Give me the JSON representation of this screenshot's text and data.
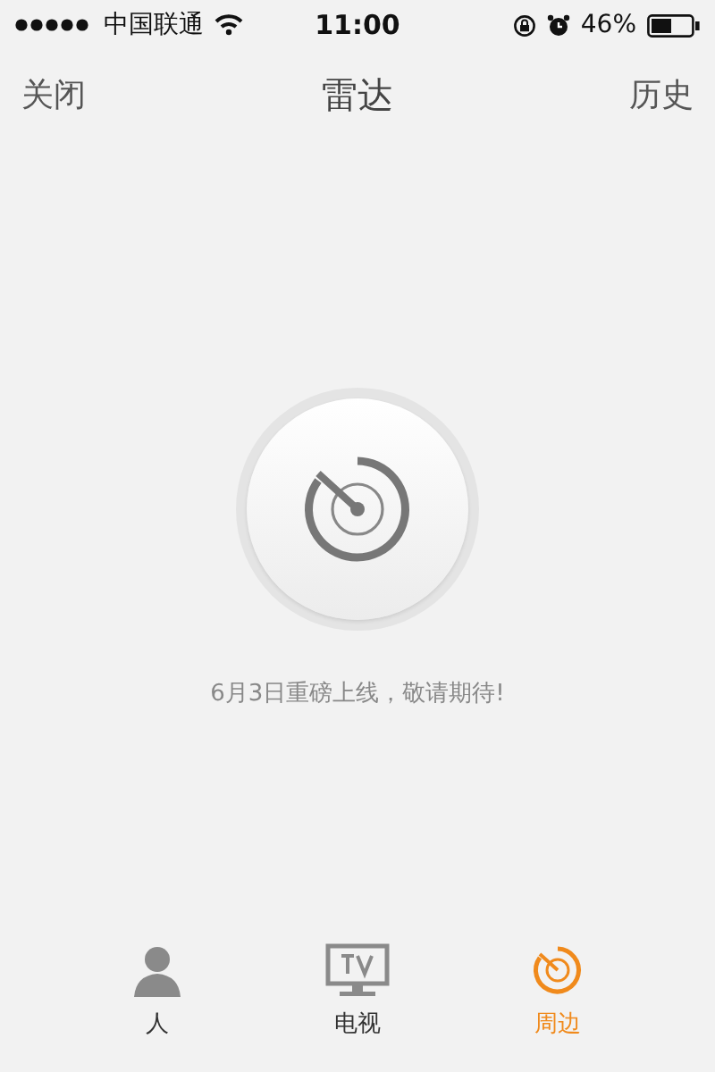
{
  "status_bar": {
    "carrier": "中国联通",
    "time": "11:00",
    "battery": "46%"
  },
  "nav": {
    "left": "关闭",
    "title": "雷达",
    "right": "历史"
  },
  "radar": {
    "message": "6月3日重磅上线，敬请期待!"
  },
  "tabs": [
    {
      "kind": "person",
      "label": "人",
      "selected": false
    },
    {
      "kind": "tv",
      "label": "电视",
      "selected": false
    },
    {
      "kind": "nearby",
      "label": "周边",
      "selected": true
    }
  ]
}
